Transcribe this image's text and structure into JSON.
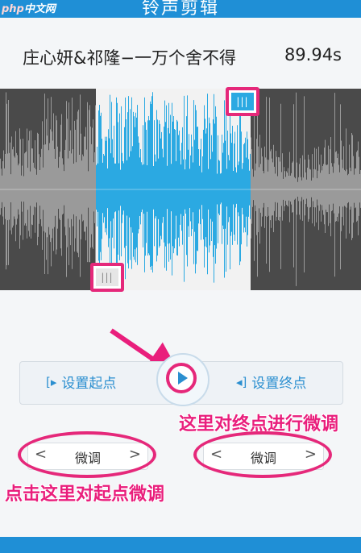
{
  "header": {
    "title": "铃声剪辑",
    "watermark_brand": "php",
    "watermark_site": "中文网"
  },
  "song": {
    "name": "庄心妍&祁隆−一万个舍不得",
    "duration": "89.94s"
  },
  "waveform": {
    "selection_start_fraction": 0.265,
    "selection_end_fraction": 0.695,
    "colors": {
      "selected": "#2ba9e2",
      "unselected": "#9a9a9a",
      "bg_unselected": "#4a4a4a",
      "bg_selected": "#f2f2f2"
    }
  },
  "handles": {
    "end_icon": "|||",
    "start_icon": "|||"
  },
  "controls": {
    "set_start_label": "设置起点",
    "set_end_label": "设置终点"
  },
  "fine_tune": {
    "label": "微调",
    "prev_icon": "<",
    "next_icon": ">"
  },
  "annotations": {
    "end_hint": "这里对终点进行微调",
    "start_hint": "点击这里对起点微调"
  },
  "colors": {
    "accent": "#e5287a",
    "brand": "#1f8fd6"
  }
}
